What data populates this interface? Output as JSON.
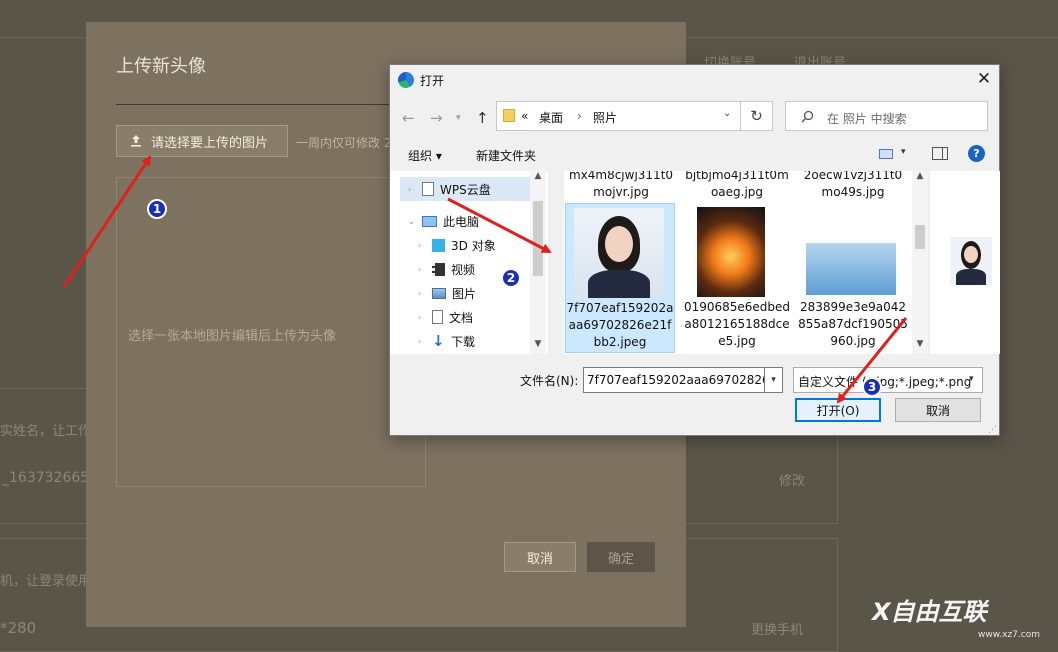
{
  "background": {
    "top_links": [
      "切换账号",
      "退出账号"
    ],
    "name_hint": "实姓名，让工作",
    "username_partial": "_163732665",
    "edit_label": "修改",
    "phone_hint": "机，让登录使用",
    "size_partial": "*280",
    "change_phone_label": "更换手机"
  },
  "modal": {
    "title": "上传新头像",
    "pick_button": "请选择要上传的图片",
    "hint": "一周内仅可修改 2",
    "preview_text": "选择一张本地图片编辑后上传为头像",
    "cancel_label": "取消",
    "confirm_label": "确定"
  },
  "dialog": {
    "title": "打开",
    "close_glyph": "✕",
    "breadcrumb": {
      "prefix": "«",
      "segments": [
        "桌面",
        "照片"
      ],
      "separator": "›"
    },
    "search_placeholder": "在 照片 中搜索",
    "toolbar": {
      "organize": "组织 ▾",
      "new_folder": "新建文件夹"
    },
    "nav": [
      {
        "label": "WPS云盘",
        "icon": "document-icon",
        "selected": true
      },
      {
        "label": "此电脑",
        "icon": "computer-icon",
        "selected": false
      },
      {
        "label": "3D 对象",
        "icon": "cube-icon",
        "selected": false
      },
      {
        "label": "视频",
        "icon": "video-icon",
        "selected": false
      },
      {
        "label": "图片",
        "icon": "picture-icon",
        "selected": false
      },
      {
        "label": "文档",
        "icon": "document-icon",
        "selected": false
      },
      {
        "label": "下载",
        "icon": "download-icon",
        "selected": false
      }
    ],
    "files_top_row": [
      "mx4m8cjwj311t0mojvr.jpg",
      "bjtbjmo4j311t0moaeg.jpg",
      "2oecw1vzj311t0mo49s.jpg"
    ],
    "files": [
      {
        "name": "7f707eaf159202aaa69702826e21fbb2.jpeg",
        "selected": true,
        "thumb": "portrait"
      },
      {
        "name": "0190685e6edbeda8012165188dcee5.jpg",
        "selected": false,
        "thumb": "fire"
      },
      {
        "name": "283899e3e9a042855a87dcf190505960.jpg",
        "selected": false,
        "thumb": "sky"
      }
    ],
    "filename_label": "文件名(N):",
    "filename_value": "7f707eaf159202aaa69702826e",
    "filetype_value": "自定义文件 (*.jpg;*.jpeg;*.png",
    "open_label": "打开(O)",
    "cancel_label": "取消"
  },
  "annotations": {
    "badges": [
      "1",
      "2",
      "3"
    ],
    "arrow_color": "#e0201c"
  },
  "watermark": {
    "text": "X自由互联",
    "sub": "www.xz7.com"
  }
}
